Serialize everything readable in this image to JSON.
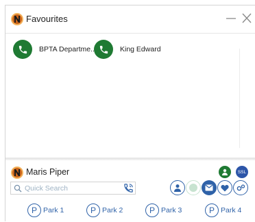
{
  "window": {
    "title": "Favourites"
  },
  "favourites": [
    {
      "label": "BPTA Departme..."
    },
    {
      "label": "King Edward"
    }
  ],
  "user": {
    "name": "Maris Piper",
    "ssl_badge": "SSL"
  },
  "search": {
    "placeholder": "Quick Search",
    "value": ""
  },
  "parks": [
    {
      "icon_letter": "P",
      "label": "Park 1"
    },
    {
      "icon_letter": "P",
      "label": "Park 2"
    },
    {
      "icon_letter": "P",
      "label": "Park 3"
    },
    {
      "icon_letter": "P",
      "label": "Park 4"
    }
  ],
  "colors": {
    "accent": "#2f62a8",
    "call_green": "#1f7a33",
    "logo_orange": "#c9641b"
  }
}
